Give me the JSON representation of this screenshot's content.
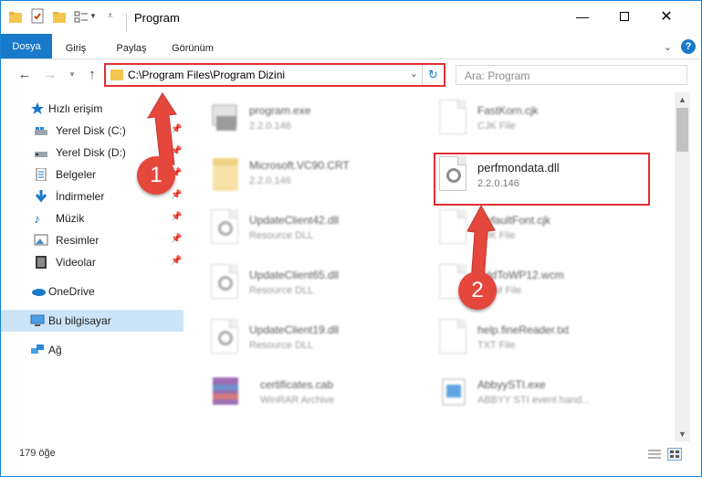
{
  "window": {
    "title": "Program"
  },
  "ribbon": {
    "tabs": [
      {
        "label": "Dosya"
      },
      {
        "label": "Giriş"
      },
      {
        "label": "Paylaş"
      },
      {
        "label": "Görünüm"
      }
    ]
  },
  "address": {
    "path": "C:\\Program Files\\Program Dizini"
  },
  "search": {
    "placeholder": "Ara: Program"
  },
  "nav": {
    "quick_access": "Hızlı erişim",
    "items": [
      {
        "label": "Yerel Disk (C:)",
        "icon": "drive-icon"
      },
      {
        "label": "Yerel Disk (D:)",
        "icon": "drive-icon"
      },
      {
        "label": "Belgeler",
        "icon": "documents-icon"
      },
      {
        "label": "İndirmeler",
        "icon": "downloads-icon"
      },
      {
        "label": "Müzik",
        "icon": "music-icon"
      },
      {
        "label": "Resimler",
        "icon": "pictures-icon"
      },
      {
        "label": "Videolar",
        "icon": "videos-icon"
      }
    ],
    "onedrive": "OneDrive",
    "this_pc": "Bu bilgisayar",
    "network": "Ağ"
  },
  "files": {
    "left": [
      {
        "name": "program.exe",
        "sub": "2.2.0.146"
      },
      {
        "name": "Microsoft.VC90.CRT",
        "sub": "2.2.0.146"
      },
      {
        "name": "UpdateClient42.dll",
        "sub": "Resource DLL"
      },
      {
        "name": "UpdateClient65.dll",
        "sub": "Resource DLL"
      },
      {
        "name": "UpdateClient19.dll",
        "sub": "Resource DLL"
      },
      {
        "name": "certificates.cab",
        "sub": "WinRAR Archive"
      }
    ],
    "right": [
      {
        "name": "FastKorn.cjk",
        "sub": "CJK File"
      },
      {
        "name": "perfmondata.dll",
        "sub": "2.2.0.146"
      },
      {
        "name": "DefaultFont.cjk",
        "sub": "CJK File"
      },
      {
        "name": "AddToWP12.wcm",
        "sub": "WCM File"
      },
      {
        "name": "help.fineReader.txt",
        "sub": "TXT File"
      },
      {
        "name": "AbbyySTI.exe",
        "sub": "ABBYY STI event hand..."
      }
    ]
  },
  "status": {
    "count": "179 öğe"
  },
  "annotations": {
    "badge1": "1",
    "badge2": "2",
    "color": "#e5473d"
  }
}
